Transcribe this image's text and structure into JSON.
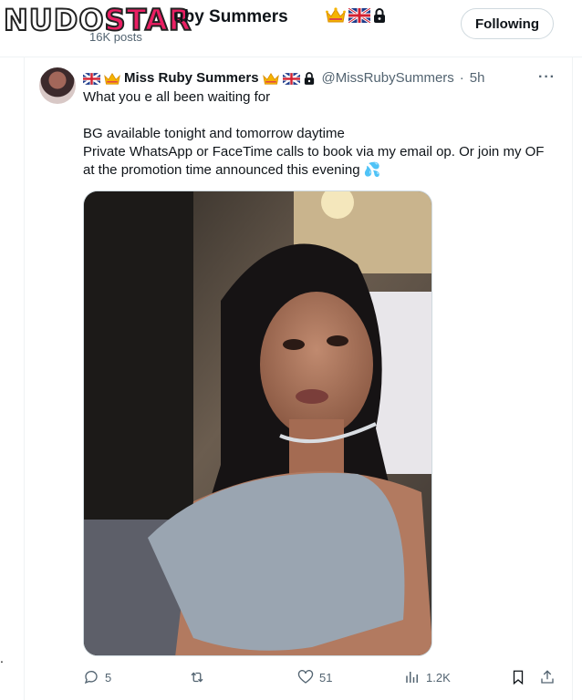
{
  "watermark": {
    "part1": "NUDO",
    "part2": "STAR"
  },
  "header": {
    "name": "uby Summers",
    "posts": "16K posts",
    "follow_label": "Following",
    "badges": [
      "crown-icon",
      "uk-flag-icon",
      "lock-icon"
    ]
  },
  "tweet": {
    "name": "Miss Ruby Summers",
    "handle": "@MissRubySummers",
    "separator": "·",
    "time": "5h",
    "more": "···",
    "lines": [
      "What you e all been waiting for",
      "",
      "BG available tonight and tomorrow daytime",
      "Private WhatsApp or FaceTime calls to book via my email op. Or join my OF at the promotion time announced this evening 💦"
    ],
    "name_prefix_icons": [
      "uk-flag-icon",
      "crown-icon"
    ],
    "name_suffix_icons": [
      "crown-icon",
      "uk-flag-icon",
      "lock-icon"
    ]
  },
  "actions": {
    "replies": "5",
    "reposts": "",
    "likes": "51",
    "views": "1.2K"
  },
  "colors": {
    "accent": "#1d9bf0",
    "muted": "#536471",
    "watermark": "#ea1f63"
  }
}
